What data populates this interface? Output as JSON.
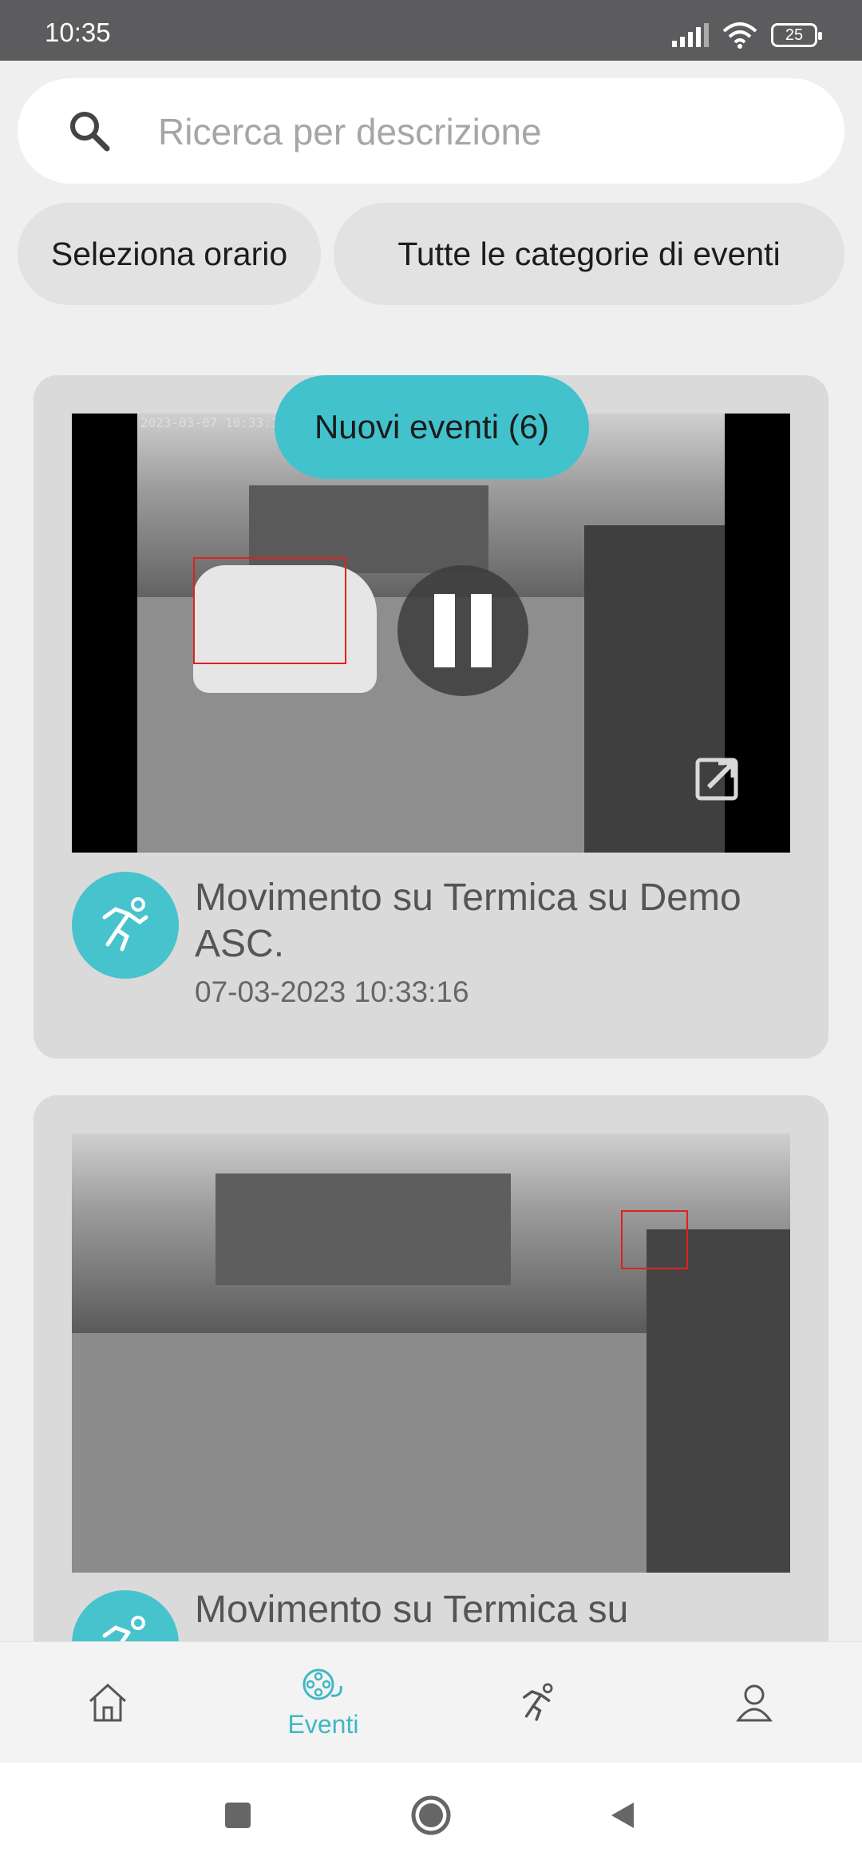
{
  "status_bar": {
    "time": "10:35",
    "battery": "25"
  },
  "search": {
    "placeholder": "Ricerca per descrizione"
  },
  "filters": {
    "time_label": "Seleziona orario",
    "category_label": "Tutte le categorie di eventi"
  },
  "new_events_badge": "Nuovi eventi (6)",
  "events": [
    {
      "title": "Movimento su Termica su Demo ASC.",
      "timestamp": "07-03-2023 10:33:16",
      "overlay_timestamp": "2023-03-07 10:33:1",
      "icon": "running-person-icon"
    },
    {
      "title": "Movimento su Termica su",
      "icon": "running-person-icon"
    }
  ],
  "bottom_nav": {
    "items": [
      {
        "id": "home",
        "icon": "home-icon",
        "label": ""
      },
      {
        "id": "events",
        "icon": "film-reel-icon",
        "label": "Eventi",
        "active": true
      },
      {
        "id": "motion",
        "icon": "running-person-icon",
        "label": ""
      },
      {
        "id": "profile",
        "icon": "user-icon",
        "label": ""
      }
    ]
  },
  "colors": {
    "accent": "#42c2cd",
    "card_bg": "#dadada",
    "page_bg": "#efefef"
  }
}
